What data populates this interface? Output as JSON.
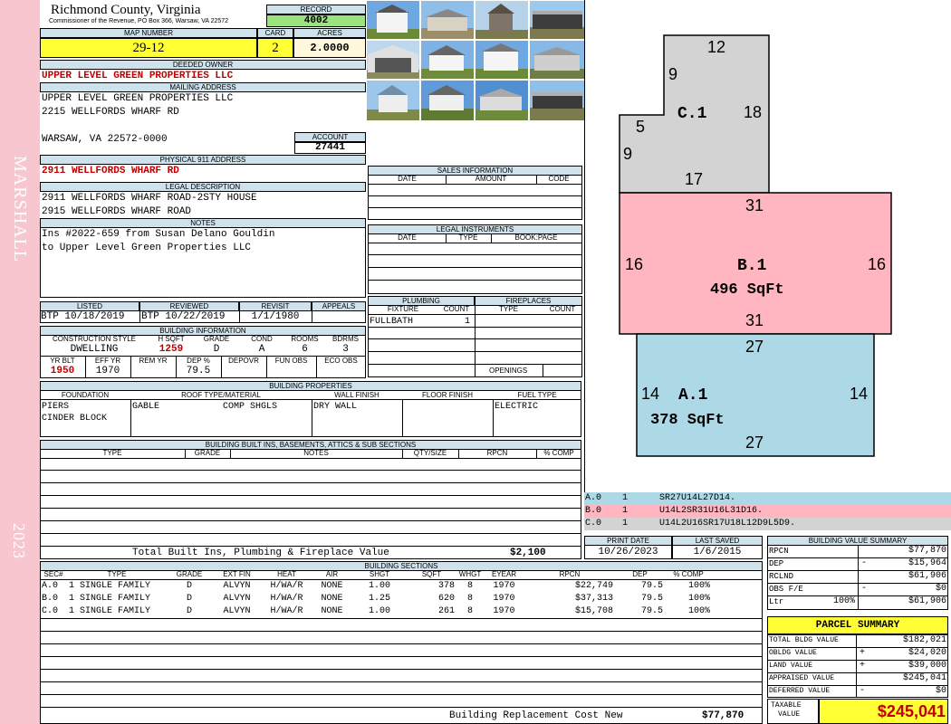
{
  "sidebar": {
    "district": "MARSHALL",
    "year": "2023"
  },
  "header": {
    "county": "Richmond County, Virginia",
    "commissioner": "Commissioner of the Revenue, PO Box 366, Warsaw, VA 22572"
  },
  "record": {
    "label": "RECORD",
    "value": "4002"
  },
  "map": {
    "label": "MAP NUMBER",
    "value": "29-12"
  },
  "card": {
    "label": "CARD",
    "value": "2"
  },
  "acres": {
    "label": "ACRES",
    "value": "2.0000"
  },
  "owner": {
    "label": "DEEDED OWNER",
    "value": "UPPER LEVEL GREEN PROPERTIES LLC"
  },
  "mailing": {
    "label": "MAILING ADDRESS",
    "line1": "UPPER LEVEL GREEN PROPERTIES LLC",
    "line2": "2215 WELLFORDS WHARF RD",
    "line3": "WARSAW, VA 22572-0000"
  },
  "account": {
    "label": "ACCOUNT",
    "value": "27441"
  },
  "physical": {
    "label": "PHYSICAL 911 ADDRESS",
    "value": "2911 WELLFORDS WHARF RD"
  },
  "legal": {
    "label": "LEGAL DESCRIPTION",
    "line1": "2911 WELLFORDS WHARF ROAD-2STY HOUSE",
    "line2": "2915 WELLFORDS WHARF ROAD"
  },
  "notes": {
    "label": "NOTES",
    "line1": "Ins #2022-659 from Susan Delano Gouldin",
    "line2": "to Upper Level Green Properties LLC"
  },
  "sales": {
    "label": "SALES INFORMATION",
    "cols": [
      "DATE",
      "AMOUNT",
      "CODE"
    ]
  },
  "instruments": {
    "label": "LEGAL INSTRUMENTS",
    "cols": [
      "DATE",
      "TYPE",
      "BOOK:PAGE"
    ]
  },
  "dates": {
    "listed_label": "LISTED",
    "listed": "BTP 10/18/2019",
    "reviewed_label": "REVIEWED",
    "reviewed": "BTP 10/22/2019",
    "revisit_label": "REVISIT",
    "revisit": "1/1/1980",
    "appeals_label": "APPEALS",
    "appeals": ""
  },
  "plumbing": {
    "label": "PLUMBING",
    "fixture_label": "FIXTURE",
    "count_label": "COUNT",
    "fixture": "FULLBATH",
    "count": "1"
  },
  "fireplaces": {
    "label": "FIREPLACES",
    "type_label": "TYPE",
    "count_label": "COUNT",
    "openings_label": "OPENINGS"
  },
  "building": {
    "label": "BUILDING INFORMATION",
    "cs_label": "CONSTRUCTION STYLE",
    "cs": "DWELLING",
    "hsqft_label": "H SQFT",
    "hsqft": "1259",
    "grade_label": "GRADE",
    "grade": "D",
    "cond_label": "COND",
    "cond": "A",
    "rooms_label": "ROOMS",
    "rooms": "6",
    "bdrms_label": "BDRMS",
    "bdrms": "3",
    "yrblt_label": "YR BLT",
    "yrblt": "1950",
    "effyr_label": "EFF YR",
    "effyr": "1970",
    "remyr_label": "REM YR",
    "remyr": "",
    "dep_label": "DEP %",
    "dep": "79.5",
    "depovr_label": "DEPOVR",
    "depovr": "",
    "funobs_label": "FUN OBS",
    "funobs": "",
    "ecoobs_label": "ECO OBS",
    "ecoobs": ""
  },
  "props": {
    "label": "BUILDING PROPERTIES",
    "foundation_label": "FOUNDATION",
    "foundation1": "PIERS",
    "foundation2": "CINDER BLOCK",
    "roof_label": "ROOF TYPE/MATERIAL",
    "roof_type": "GABLE",
    "roof_mat": "COMP SHGLS",
    "wall_label": "WALL FINISH",
    "wall": "DRY WALL",
    "floor_label": "FLOOR FINISH",
    "floor": "",
    "fuel_label": "FUEL TYPE",
    "fuel": "ELECTRIC"
  },
  "builtins": {
    "label": "BUILDING BUILT INS, BASEMENTS, ATTICS & SUB SECTIONS",
    "cols": [
      "TYPE",
      "GRADE",
      "NOTES",
      "QTY/SIZE",
      "RPCN",
      "% COMP"
    ],
    "total_label": "Total Built Ins, Plumbing & Fireplace Value",
    "total": "$2,100"
  },
  "sections": {
    "label": "BUILDING SECTIONS",
    "cols": [
      "SEC#",
      "TYPE",
      "GRADE",
      "EXT FIN",
      "HEAT",
      "AIR",
      "SHGT",
      "SQFT",
      "WHGT",
      "EYEAR",
      "RPCN",
      "DEP",
      "% COMP"
    ],
    "rows": [
      {
        "sec": "A.0",
        "type": "1 SINGLE FAMILY",
        "grade": "D",
        "ext": "ALVYN",
        "heat": "H/WA/R",
        "air": "NONE",
        "shgt": "1.00",
        "sqft": "378",
        "whgt": "8",
        "eyear": "1970",
        "rpcn": "$22,749",
        "dep": "79.5",
        "comp": "100%"
      },
      {
        "sec": "B.0",
        "type": "1 SINGLE FAMILY",
        "grade": "D",
        "ext": "ALVYN",
        "heat": "H/WA/R",
        "air": "NONE",
        "shgt": "1.25",
        "sqft": "620",
        "whgt": "8",
        "eyear": "1970",
        "rpcn": "$37,313",
        "dep": "79.5",
        "comp": "100%"
      },
      {
        "sec": "C.0",
        "type": "1 SINGLE FAMILY",
        "grade": "D",
        "ext": "ALVYN",
        "heat": "H/WA/R",
        "air": "NONE",
        "shgt": "1.00",
        "sqft": "261",
        "whgt": "8",
        "eyear": "1970",
        "rpcn": "$15,708",
        "dep": "79.5",
        "comp": "100%"
      }
    ],
    "brcn_label": "Building Replacement Cost New",
    "brcn": "$77,870"
  },
  "sketch": {
    "c_label": "C.1",
    "c_top": "12",
    "c_step": "9",
    "c_left": "5",
    "c_left2": "9",
    "c_right": "18",
    "c_bottom": "17",
    "b_label": "B.1",
    "b_area": "496 SqFt",
    "b_top": "31",
    "b_left": "16",
    "b_right": "16",
    "b_bottom": "31",
    "a_label": "A.1",
    "a_area": "378 SqFt",
    "a_top": "27",
    "a_left": "14",
    "a_right": "14",
    "a_bottom": "27"
  },
  "vectors": [
    {
      "sec": "A.0",
      "n": "1",
      "code": "SR27U14L27D14."
    },
    {
      "sec": "B.0",
      "n": "1",
      "code": "U14L2SR31U16L31D16."
    },
    {
      "sec": "C.0",
      "n": "1",
      "code": "U14L2U16SR17U18L12D9L5D9."
    }
  ],
  "print": {
    "print_label": "PRINT DATE",
    "print": "10/26/2023",
    "saved_label": "LAST SAVED",
    "saved": "1/6/2015"
  },
  "bvs": {
    "label": "BUILDING VALUE SUMMARY",
    "rpcn_label": "RPCN",
    "rpcn": "$77,870",
    "dep_label": "DEP",
    "dep_sign": "-",
    "dep": "$15,964",
    "rclnd_label": "RCLND",
    "rclnd": "$61,906",
    "obs_label": "OBS F/E",
    "obs_sign": "-",
    "obs": "$0",
    "ltr_label": "Ltr",
    "ltr_pct": "100%",
    "ltr": "$61,906"
  },
  "parcel": {
    "label": "PARCEL SUMMARY",
    "tbv_label": "TOTAL BLDG VALUE",
    "tbv": "$182,021",
    "obldg_label": "OBLDG VALUE",
    "obldg_sign": "+",
    "obldg": "$24,020",
    "land_label": "LAND VALUE",
    "land_sign": "+",
    "land": "$39,000",
    "appr_label": "APPRAISED VALUE",
    "appr": "$245,041",
    "def_label": "DEFERRED VALUE",
    "def_sign": "-",
    "def": "$0",
    "tax_label1": "TAXABLE",
    "tax_label2": "VALUE",
    "tax": "$245,041"
  },
  "colors": {
    "sidebar": "#f7c6cf",
    "header_bg": "#cfe2ec",
    "record_bg": "#9be37f",
    "yellow": "#ffff33",
    "pink": "#ffb6c1",
    "blue": "#add8e6",
    "gray": "#d3d3d3",
    "red": "#c00000"
  }
}
